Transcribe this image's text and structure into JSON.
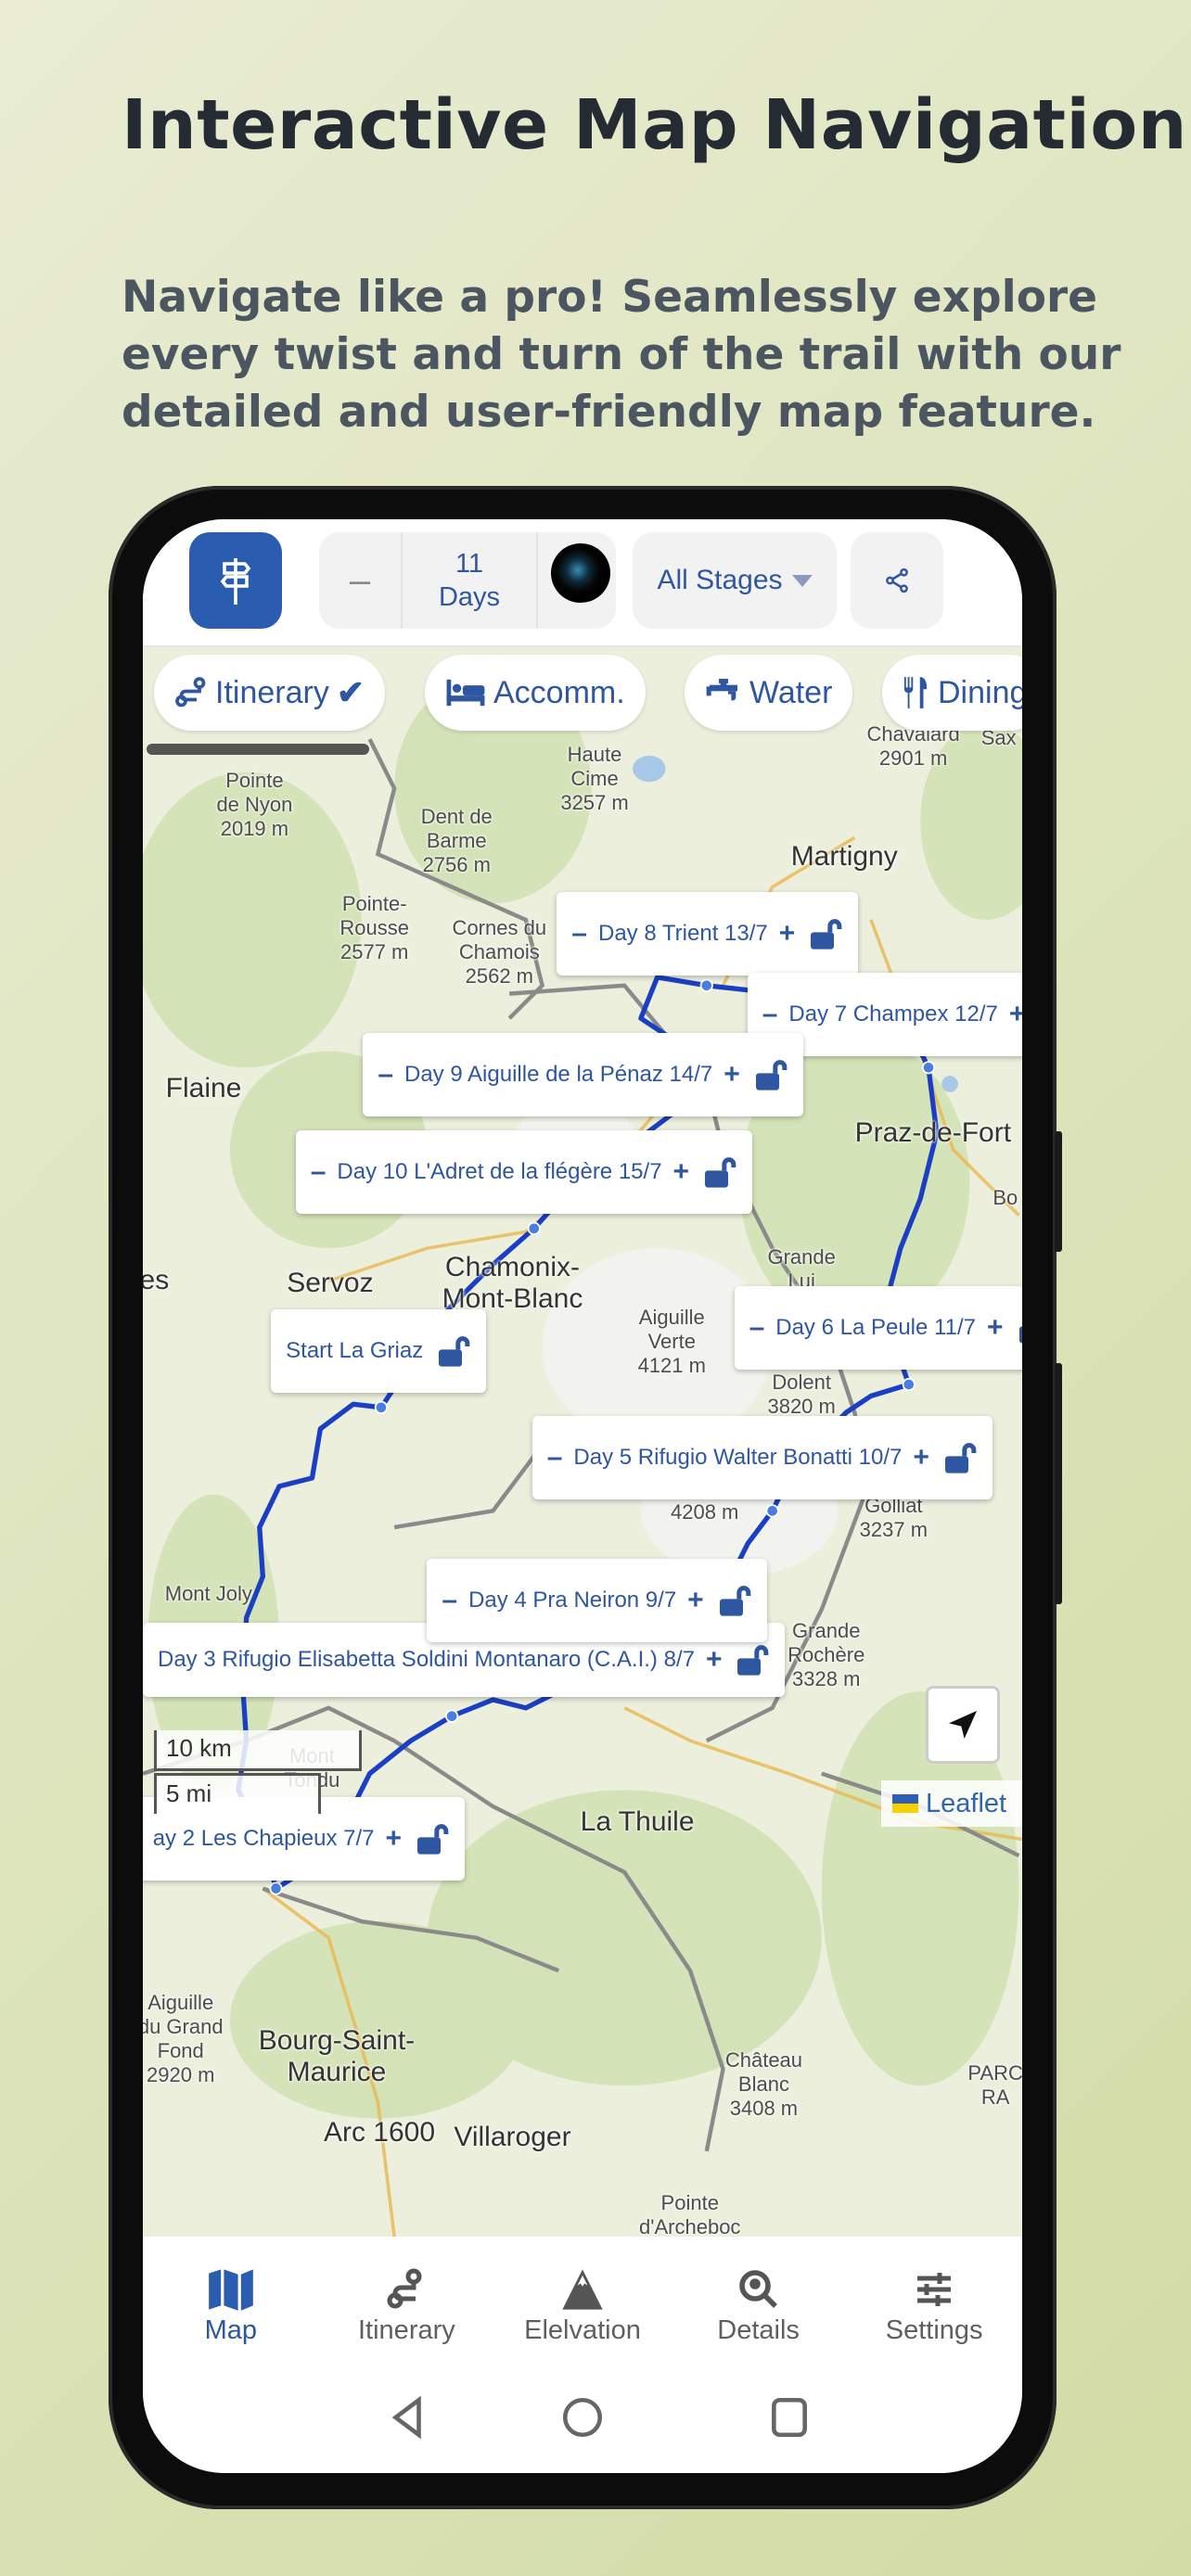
{
  "promo": {
    "title": "Interactive Map Navigation",
    "subtitle": "Navigate like a pro! Seamlessly explore every twist and turn of the trail with our detailed and user-friendly map feature."
  },
  "topbar": {
    "logo_icon": "signpost-icon",
    "days_minus": "–",
    "days_count": "11",
    "days_unit": "Days",
    "stages_select": "All Stages",
    "share_icon": "share-icon"
  },
  "filters": [
    {
      "label": "Itinerary",
      "icon": "route-icon",
      "checked": true
    },
    {
      "label": "Accomm.",
      "icon": "bed-icon"
    },
    {
      "label": "Water",
      "icon": "tap-icon"
    },
    {
      "label": "Dining",
      "icon": "fork-knife-icon"
    }
  ],
  "map": {
    "places": [
      {
        "name": "Pointe\nde Nyon\n2019 m"
      },
      {
        "name": "Haute\nCime\n3257 m"
      },
      {
        "name": "Dent de\nBarme\n2756 m"
      },
      {
        "name": "Chavalard\n2901 m"
      },
      {
        "name": "Sax"
      },
      {
        "name": "Martigny"
      },
      {
        "name": "Pointe-\nRousse\n2577 m"
      },
      {
        "name": "Cornes du\nChamois\n2562 m"
      },
      {
        "name": "Flaine"
      },
      {
        "name": "Praz-de-Fort"
      },
      {
        "name": "Bo"
      },
      {
        "name": "es"
      },
      {
        "name": "Servoz"
      },
      {
        "name": "Chamonix-\nMont-Blanc"
      },
      {
        "name": "Aiguille\nVerte\n4121 m"
      },
      {
        "name": "Grande\nLui"
      },
      {
        "name": "Mont\nDolent\n3820 m"
      },
      {
        "name": "Pointe\nWalker\n4208 m"
      },
      {
        "name": "Grand\nGolliat\n3237 m"
      },
      {
        "name": "Mont Joly"
      },
      {
        "name": "Grande\nRochère\n3328 m"
      },
      {
        "name": "Mont\nTondu"
      },
      {
        "name": "La Thuile"
      },
      {
        "name": "Aiguille\ndu Grand\nFond\n2920 m"
      },
      {
        "name": "Bourg-Saint-\nMaurice"
      },
      {
        "name": "Arc 1600"
      },
      {
        "name": "Villaroger"
      },
      {
        "name": "Château\nBlanc\n3408 m"
      },
      {
        "name": "Pointe\nd'Archeboc"
      },
      {
        "name": "PARC\nRA"
      }
    ],
    "stages": [
      {
        "label": "Day 8 Trient 13/7",
        "minus": true,
        "plus": true
      },
      {
        "label": "Day 7 Champex 12/7",
        "minus": true,
        "plus": true
      },
      {
        "label": "Day 9 Aiguille de la Pénaz 14/7",
        "minus": true,
        "plus": true
      },
      {
        "label": "Day 10 L'Adret de la flégère 15/7",
        "minus": true,
        "plus": true
      },
      {
        "label": "Start La Griaz",
        "minus": false,
        "plus": false
      },
      {
        "label": "Day 6 La Peule 11/7",
        "minus": true,
        "plus": true
      },
      {
        "label": "Day 5 Rifugio Walter Bonatti 10/7",
        "minus": true,
        "plus": true
      },
      {
        "label": "Day 4 Pra Neiron 9/7",
        "minus": true,
        "plus": true
      },
      {
        "label": "Day 3 Rifugio Elisabetta Soldini Montanaro (C.A.I.) 8/7",
        "minus": false,
        "plus": true
      },
      {
        "label": "ay 2 Les Chapieux 7/7",
        "minus": false,
        "plus": true
      }
    ],
    "minus_symbol": "–",
    "plus_symbol": "+",
    "scale_km": "10 km",
    "scale_mi": "5 mi",
    "attribution": "Leaflet",
    "route_color": "#1a3fc4"
  },
  "bottom_nav": [
    {
      "label": "Map",
      "icon": "map-icon",
      "active": true
    },
    {
      "label": "Itinerary",
      "icon": "route-icon"
    },
    {
      "label": "Elelvation",
      "icon": "mountain-icon"
    },
    {
      "label": "Details",
      "icon": "search-location-icon"
    },
    {
      "label": "Settings",
      "icon": "sliders-icon"
    }
  ],
  "colors": {
    "accent": "#2a5cb0",
    "text_blue": "#2f56a0"
  }
}
